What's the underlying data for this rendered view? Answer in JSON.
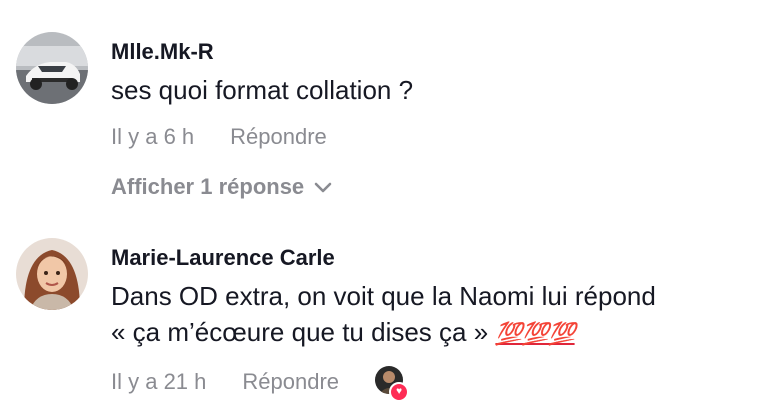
{
  "comments": [
    {
      "author": "Mlle.Mk-R",
      "text": "ses quoi format collation ?",
      "time": "Il y a 6 h",
      "reply_label": "Répondre",
      "view_replies_label": "Afficher 1 réponse"
    },
    {
      "author": "Marie-Laurence Carle",
      "text_line1": "Dans OD extra, on voit que la Naomi lui répond",
      "text_line2": "« ça m’écœure que tu dises ça » ",
      "emoji": "💯💯💯",
      "time": "Il y a 21 h",
      "reply_label": "Répondre"
    }
  ],
  "colors": {
    "text_primary": "#161823",
    "text_secondary": "#8a8b91",
    "like_heart": "#fe2c55"
  },
  "icons": {
    "view_replies": "chevron-down-icon",
    "creator_like": "heart-icon"
  }
}
